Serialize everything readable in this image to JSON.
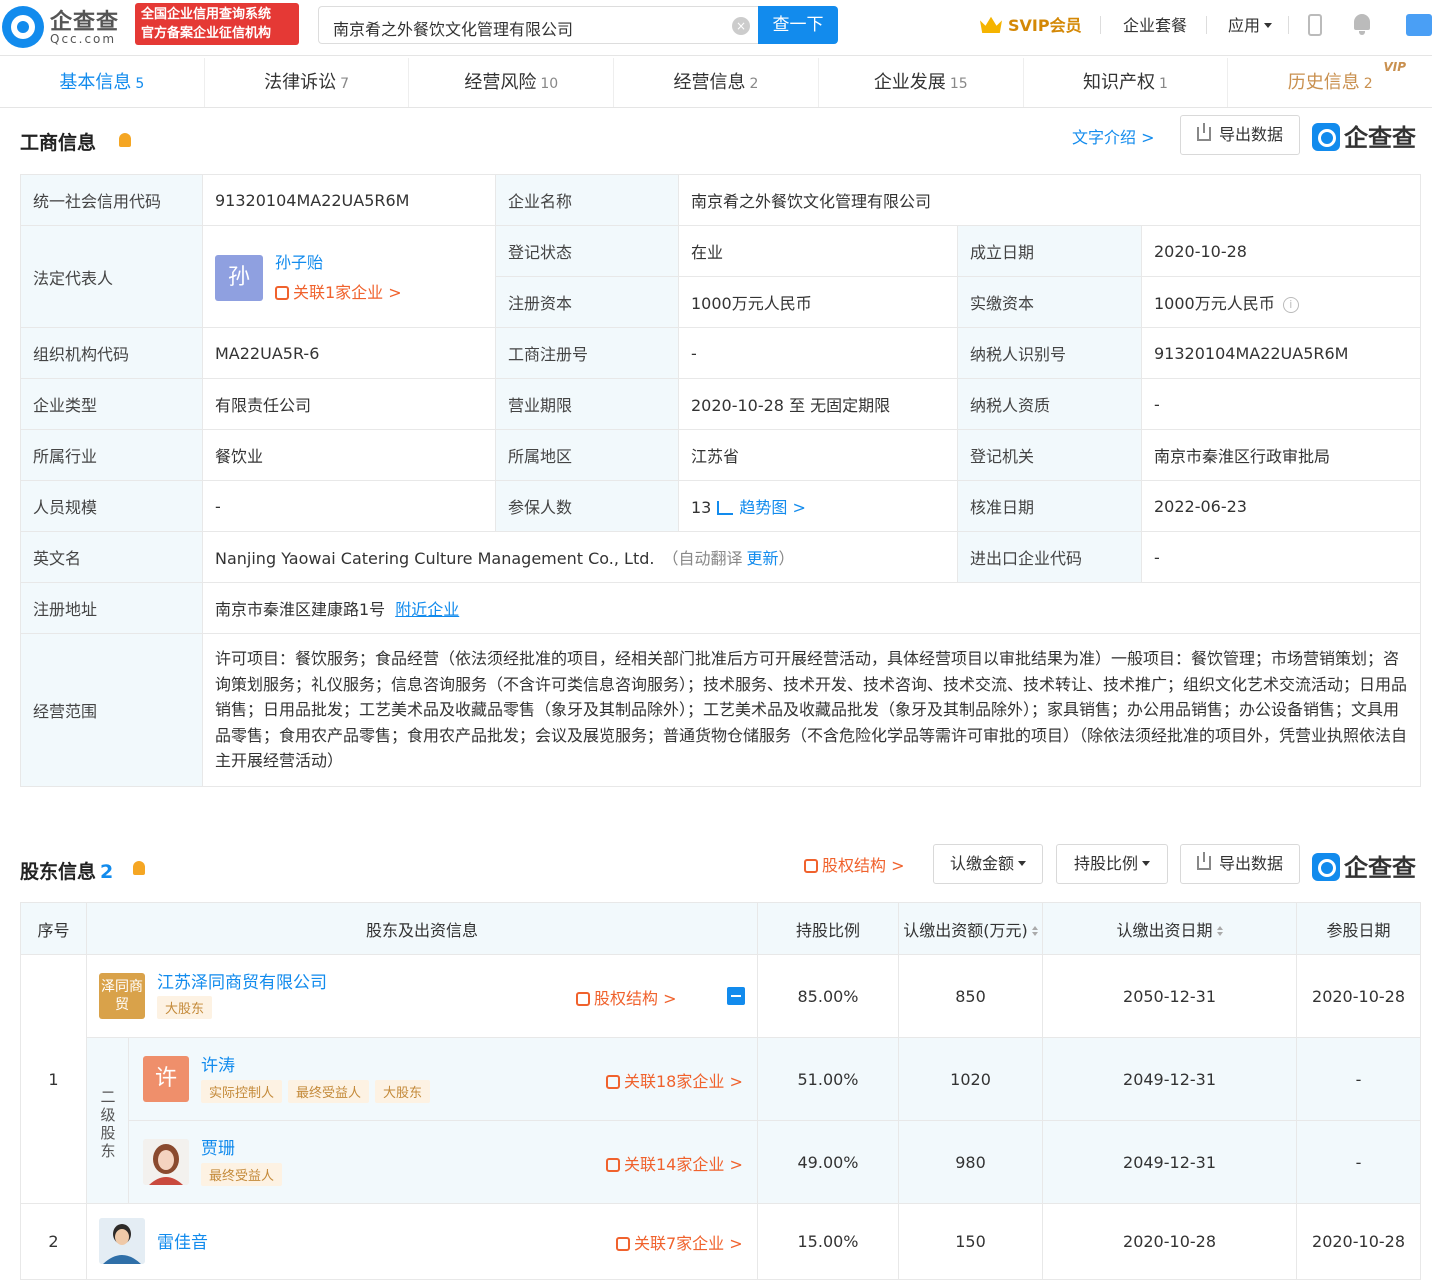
{
  "header": {
    "logo_cn": "企查查",
    "logo_en": "Qcc.com",
    "badge_line1": "全国企业信用查询系统",
    "badge_line2": "官方备案企业征信机构",
    "search_value": "南京肴之外餐饮文化管理有限公司",
    "search_btn": "查一下",
    "svip": "SVIP会员",
    "package": "企业套餐",
    "apps": "应用"
  },
  "tabs": [
    {
      "label": "基本信息",
      "count": "5"
    },
    {
      "label": "法律诉讼",
      "count": "7"
    },
    {
      "label": "经营风险",
      "count": "10"
    },
    {
      "label": "经营信息",
      "count": "2"
    },
    {
      "label": "企业发展",
      "count": "15"
    },
    {
      "label": "知识产权",
      "count": "1"
    },
    {
      "label": "历史信息",
      "count": "2",
      "vip": "VIP"
    }
  ],
  "biz": {
    "title": "工商信息",
    "text_intro": "文字介绍 >",
    "export": "导出数据",
    "brand": "企查查",
    "credit_code_k": "统一社会信用代码",
    "credit_code": "91320104MA22UA5R6M",
    "name_k": "企业名称",
    "name": "南京肴之外餐饮文化管理有限公司",
    "legal_k": "法定代表人",
    "legal_avatar": "孙",
    "legal_name": "孙子贻",
    "legal_rel": "关联1家企业 >",
    "status_k": "登记状态",
    "status": "在业",
    "found_k": "成立日期",
    "found": "2020-10-28",
    "capital_k": "注册资本",
    "capital": "1000万元人民币",
    "paid_k": "实缴资本",
    "paid": "1000万元人民币",
    "org_k": "组织机构代码",
    "org": "MA22UA5R-6",
    "regno_k": "工商注册号",
    "regno": "-",
    "tax_k": "纳税人识别号",
    "tax": "91320104MA22UA5R6M",
    "type_k": "企业类型",
    "type": "有限责任公司",
    "term_k": "营业期限",
    "term": "2020-10-28 至 无固定期限",
    "taxq_k": "纳税人资质",
    "taxq": "-",
    "industry_k": "所属行业",
    "industry": "餐饮业",
    "region_k": "所属地区",
    "region": "江苏省",
    "authority_k": "登记机关",
    "authority": "南京市秦淮区行政审批局",
    "staff_k": "人员规模",
    "staff": "-",
    "insured_k": "参保人数",
    "insured": "13",
    "trend": "趋势图 >",
    "approve_k": "核准日期",
    "approve": "2022-06-23",
    "en_k": "英文名",
    "en": "Nanjing Yaowai Catering Culture Management Co., Ltd.",
    "en_auto": "（自动翻译",
    "en_update": "更新",
    "en_close": "）",
    "ie_k": "进出口企业代码",
    "ie": "-",
    "addr_k": "注册地址",
    "addr": "南京市秦淮区建康路1号",
    "nearby": "附近企业",
    "scope_k": "经营范围",
    "scope": "许可项目：餐饮服务；食品经营（依法须经批准的项目，经相关部门批准后方可开展经营活动，具体经营项目以审批结果为准）一般项目：餐饮管理；市场营销策划；咨询策划服务；礼仪服务；信息咨询服务（不含许可类信息咨询服务）；技术服务、技术开发、技术咨询、技术交流、技术转让、技术推广；组织文化艺术交流活动；日用品销售；日用品批发；工艺美术品及收藏品零售（象牙及其制品除外）；工艺美术品及收藏品批发（象牙及其制品除外）；家具销售；办公用品销售；办公设备销售；文具用品零售；食用农产品零售；食用农产品批发；会议及展览服务；普通货物仓储服务（不含危险化学品等需许可审批的项目）（除依法须经批准的项目外，凭营业执照依法自主开展经营活动）"
  },
  "shareholders": {
    "title": "股东信息",
    "count": "2",
    "equity_struct": "股权结构 >",
    "sub_amount": "认缴金额",
    "hold_ratio": "持股比例",
    "export": "导出数据",
    "brand": "企查查",
    "cols": {
      "idx": "序号",
      "info": "股东及出资信息",
      "ratio": "持股比例",
      "amount": "认缴出资额(万元)",
      "date": "认缴出资日期",
      "join": "参股日期"
    },
    "sublevel": "二级股东",
    "rows": [
      {
        "idx": "1",
        "logo": "泽同商贸",
        "name": "江苏泽同商贸有限公司",
        "tag": "大股东",
        "link": "股权结构 >",
        "ratio": "85.00%",
        "amount": "850",
        "date": "2050-12-31",
        "join": "2020-10-28"
      },
      {
        "avatar": "许",
        "name": "许涛",
        "tags": [
          "实际控制人",
          "最终受益人",
          "大股东"
        ],
        "link": "关联18家企业 >",
        "ratio": "51.00%",
        "amount": "1020",
        "date": "2049-12-31",
        "join": "-"
      },
      {
        "name": "贾珊",
        "tags": [
          "最终受益人"
        ],
        "link": "关联14家企业 >",
        "ratio": "49.00%",
        "amount": "980",
        "date": "2049-12-31",
        "join": "-"
      },
      {
        "idx": "2",
        "name": "雷佳音",
        "link": "关联7家企业 >",
        "ratio": "15.00%",
        "amount": "150",
        "date": "2020-10-28",
        "join": "2020-10-28"
      }
    ]
  }
}
